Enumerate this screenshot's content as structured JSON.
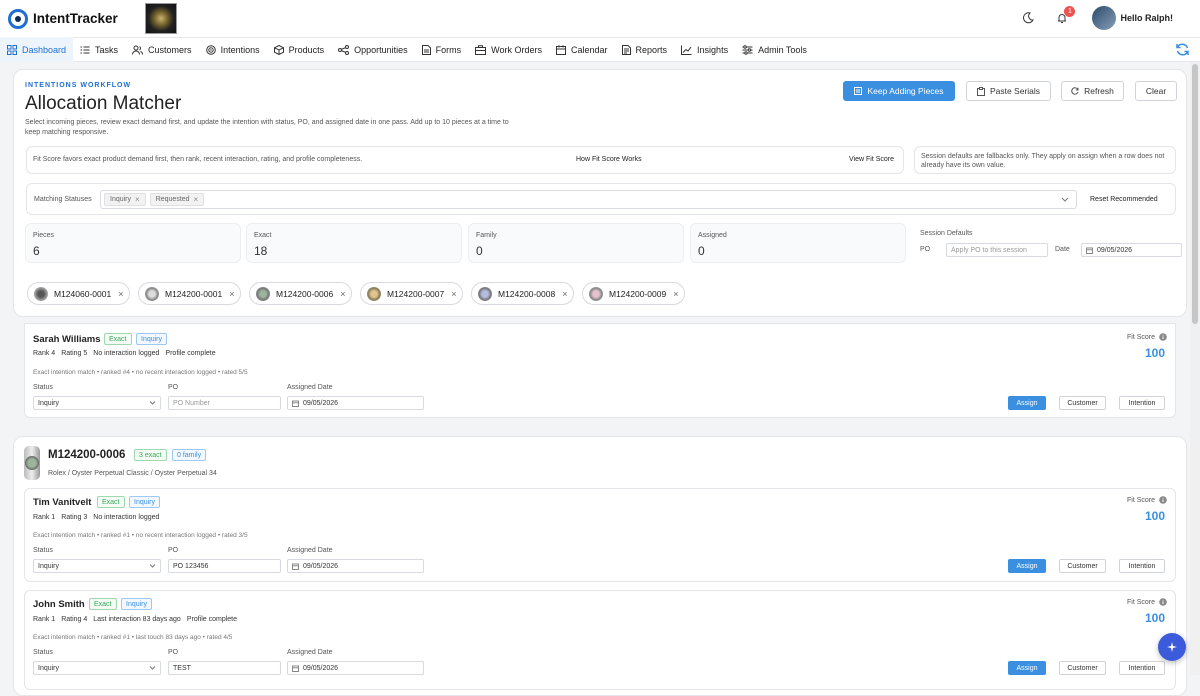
{
  "app": {
    "name": "IntentTracker",
    "greeting": "Hello Ralph!",
    "notification_count": "1"
  },
  "nav": {
    "items": [
      {
        "label": "Dashboard",
        "icon": "grid-icon"
      },
      {
        "label": "Tasks",
        "icon": "list-icon"
      },
      {
        "label": "Customers",
        "icon": "users-icon"
      },
      {
        "label": "Intentions",
        "icon": "target-icon"
      },
      {
        "label": "Products",
        "icon": "box-icon"
      },
      {
        "label": "Opportunities",
        "icon": "share-icon"
      },
      {
        "label": "Forms",
        "icon": "document-icon"
      },
      {
        "label": "Work Orders",
        "icon": "briefcase-icon"
      },
      {
        "label": "Calendar",
        "icon": "calendar-icon"
      },
      {
        "label": "Reports",
        "icon": "report-icon"
      },
      {
        "label": "Insights",
        "icon": "chart-icon"
      },
      {
        "label": "Admin Tools",
        "icon": "sliders-icon"
      }
    ],
    "active": "Dashboard"
  },
  "header": {
    "eyebrow": "INTENTIONS WORKFLOW",
    "title": "Allocation Matcher",
    "subtitle": "Select incoming pieces, review exact demand first, and update the intention with status, PO, and assigned date in one pass. Add up to 10 pieces at a time to keep matching responsive.",
    "buttons": {
      "keep_adding": "Keep Adding Pieces",
      "paste_serials": "Paste Serials",
      "refresh": "Refresh",
      "clear": "Clear"
    }
  },
  "fit_info": {
    "text": "Fit Score favors exact product demand first, then rank, recent interaction, rating, and profile completeness.",
    "how_link": "How Fit Score Works",
    "view_link": "View Fit Score",
    "session_note": "Session defaults are fallbacks only. They apply on assign when a row does not already have its own value."
  },
  "filters": {
    "label": "Matching Statuses",
    "statuses": [
      "Inquiry",
      "Requested"
    ],
    "reset": "Reset Recommended"
  },
  "stats": [
    {
      "label": "Pieces",
      "value": "6"
    },
    {
      "label": "Exact",
      "value": "18"
    },
    {
      "label": "Family",
      "value": "0"
    },
    {
      "label": "Assigned",
      "value": "0"
    }
  ],
  "session_defaults": {
    "title": "Session Defaults",
    "po_label": "PO",
    "po_placeholder": "Apply PO to this session",
    "date_label": "Date",
    "date_value": "09/05/2026"
  },
  "pieces": [
    "M124060-0001",
    "M124200-0001",
    "M124200-0006",
    "M124200-0007",
    "M124200-0008",
    "M124200-0009"
  ],
  "labels": {
    "status": "Status",
    "po": "PO",
    "assigned_date": "Assigned Date",
    "fit_score": "Fit Score",
    "assign": "Assign",
    "customer": "Customer",
    "intention": "Intention",
    "po_placeholder": "PO Number"
  },
  "first_row": {
    "name": "Sarah Williams",
    "match": "Exact",
    "status_tag": "Inquiry",
    "meta": [
      "Rank 4",
      "Rating 5",
      "No interaction logged",
      "Profile complete"
    ],
    "note": "Exact intention match • ranked #4 • no recent interaction logged • rated 5/5",
    "status": "Inquiry",
    "po": "",
    "date": "09/05/2026",
    "fit_score": "100"
  },
  "group": {
    "piece": "M124200-0006",
    "exact_badge": "3 exact",
    "family_badge": "0 family",
    "model": "Rolex / Oyster Perpetual Classic / Oyster Perpetual 34",
    "rows": [
      {
        "name": "Tim Vanitvelt",
        "match": "Exact",
        "status_tag": "Inquiry",
        "meta": [
          "Rank 1",
          "Rating 3",
          "No interaction logged"
        ],
        "note": "Exact intention match • ranked #1 • no recent interaction logged • rated 3/5",
        "status": "Inquiry",
        "po": "PO 123456",
        "date": "09/05/2026",
        "fit_score": "100"
      },
      {
        "name": "John Smith",
        "match": "Exact",
        "status_tag": "Inquiry",
        "meta": [
          "Rank 1",
          "Rating 4",
          "Last interaction 83 days ago",
          "Profile complete"
        ],
        "note": "Exact intention match • ranked #1 • last touch 83 days ago • rated 4/5",
        "status": "Inquiry",
        "po": "TEST",
        "date": "09/05/2026",
        "fit_score": "100"
      }
    ]
  },
  "colors": {
    "accent": "#3b8fe0",
    "exact": "#3aa85a",
    "fab": "#3b5bdb"
  }
}
